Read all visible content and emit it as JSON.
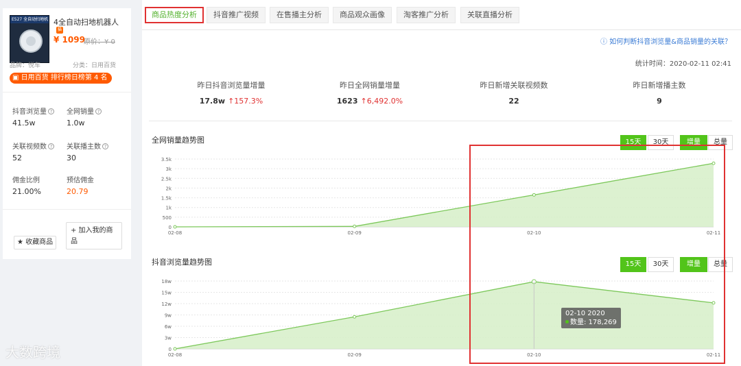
{
  "product": {
    "image_banner": "E527 全自动扫地机",
    "title": "4全自动扫地机器人",
    "store_badge": "猫",
    "price": "¥ 1099",
    "original_price": "原价：¥ 0",
    "brand": "品牌：悦车",
    "category": "分类：日用百货",
    "rank_badge": "日用百货 排行榜日榜第 4 名",
    "stats": [
      {
        "label": "抖音浏览量",
        "value": "41.5w"
      },
      {
        "label": "全网销量",
        "value": "1.0w"
      },
      {
        "label": "关联视频数",
        "value": "52"
      },
      {
        "label": "关联播主数",
        "value": "30"
      },
      {
        "label": "佣金比例",
        "value": "21.00%"
      },
      {
        "label": "预估佣金",
        "value": "20.79"
      }
    ],
    "add_button": "+ 加入我的商品",
    "fav_button": "★ 收藏商品"
  },
  "watermark": "大数跨境",
  "tabs": [
    {
      "label": "商品热度分析",
      "active": true
    },
    {
      "label": "抖音推广视频",
      "active": false
    },
    {
      "label": "在售播主分析",
      "active": false
    },
    {
      "label": "商品观众画像",
      "active": false
    },
    {
      "label": "淘客推广分析",
      "active": false
    },
    {
      "label": "关联直播分析",
      "active": false
    }
  ],
  "help_link": "ⓘ 如何判断抖音浏览量&商品销量的关联？",
  "stat_time": "统计时间：2020-02-11 02:41",
  "kpis": [
    {
      "label": "昨日抖音浏览量增量",
      "value": "17.8w",
      "change": "↑157.3%"
    },
    {
      "label": "昨日全网销量增量",
      "value": "1623",
      "change": "↑6,492.0%"
    },
    {
      "label": "昨日新增关联视频数",
      "value": "22",
      "change": ""
    },
    {
      "label": "昨日新增播主数",
      "value": "9",
      "change": ""
    }
  ],
  "chart_controls": {
    "days15": "15天",
    "days30": "30天",
    "increment": "增量",
    "total": "总量"
  },
  "tooltip": {
    "date": "02-10 2020",
    "label": "数量: 178,269"
  },
  "colors": {
    "accent_green": "#52c41a",
    "line_green": "#7cc85a",
    "fill_green": "#d6efc8",
    "highlight_red": "#e03131",
    "price_orange": "#ff5a00"
  },
  "chart_data": [
    {
      "type": "area",
      "title": "全网销量趋势图",
      "x": [
        "02-08",
        "02-09",
        "02-10",
        "02-11"
      ],
      "values": [
        0,
        25,
        1650,
        3280
      ],
      "y_ticks": [
        "0",
        "500",
        "1k",
        "1.5k",
        "2k",
        "2.5k",
        "3k",
        "3.5k"
      ],
      "ylim": [
        0,
        3500
      ],
      "grid": true
    },
    {
      "type": "area",
      "title": "抖音浏览量趋势图",
      "x": [
        "02-08",
        "02-09",
        "02-10",
        "02-11"
      ],
      "values": [
        0,
        85000,
        178269,
        122000
      ],
      "y_ticks": [
        "0",
        "3w",
        "6w",
        "9w",
        "12w",
        "15w",
        "18w"
      ],
      "ylim": [
        0,
        180000
      ],
      "grid": true
    }
  ]
}
